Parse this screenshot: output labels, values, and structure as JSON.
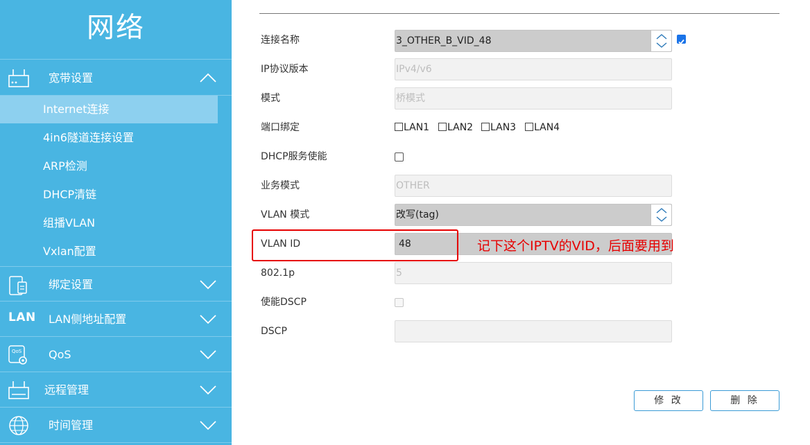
{
  "sidebar": {
    "title": "网络",
    "groups": [
      {
        "label": "宽带设置",
        "icon": "router-icon",
        "expanded": true
      },
      {
        "label": "绑定设置",
        "icon": "device-bind-icon",
        "expanded": false
      },
      {
        "label": "LAN侧地址配置",
        "icon": "lan-icon",
        "icon_text": "LAN",
        "expanded": false
      },
      {
        "label": "QoS",
        "icon": "qos-gear-icon",
        "expanded": false
      },
      {
        "label": "远程管理",
        "icon": "router-icon",
        "expanded": false
      },
      {
        "label": "时间管理",
        "icon": "globe-icon",
        "expanded": false
      }
    ],
    "subitems": [
      {
        "label": "Internet连接",
        "active": true
      },
      {
        "label": "4in6隧道连接设置"
      },
      {
        "label": "ARP检测"
      },
      {
        "label": "DHCP清链"
      },
      {
        "label": "组播VLAN"
      },
      {
        "label": "Vxlan配置"
      }
    ]
  },
  "form": {
    "connection_name": {
      "label": "连接名称",
      "value": "3_OTHER_B_VID_48",
      "checked": true
    },
    "ip_version": {
      "label": "IP协议版本",
      "value": "IPv4/v6"
    },
    "mode": {
      "label": "模式",
      "value": "桥模式"
    },
    "port_binding": {
      "label": "端口绑定",
      "options": [
        "LAN1",
        "LAN2",
        "LAN3",
        "LAN4"
      ]
    },
    "dhcp_server": {
      "label": "DHCP服务使能",
      "checked": false
    },
    "service_mode": {
      "label": "业务模式",
      "value": "OTHER"
    },
    "vlan_mode": {
      "label": "VLAN 模式",
      "value": "改写(tag)"
    },
    "vlan_id": {
      "label": "VLAN ID",
      "value": "48"
    },
    "p8021": {
      "label": "802.1p",
      "value": "5"
    },
    "enable_dscp": {
      "label": "使能DSCP",
      "checked": false
    },
    "dscp": {
      "label": "DSCP",
      "value": ""
    }
  },
  "annotation": "记下这个IPTV的VID，后面要用到",
  "buttons": {
    "modify": "修 改",
    "delete": "删 除"
  },
  "colors": {
    "sidebar_bg": "#49b5e2",
    "active_item_bg": "#8dd0ef",
    "annotation_red": "#e60000",
    "button_border": "#3a9bd6"
  }
}
